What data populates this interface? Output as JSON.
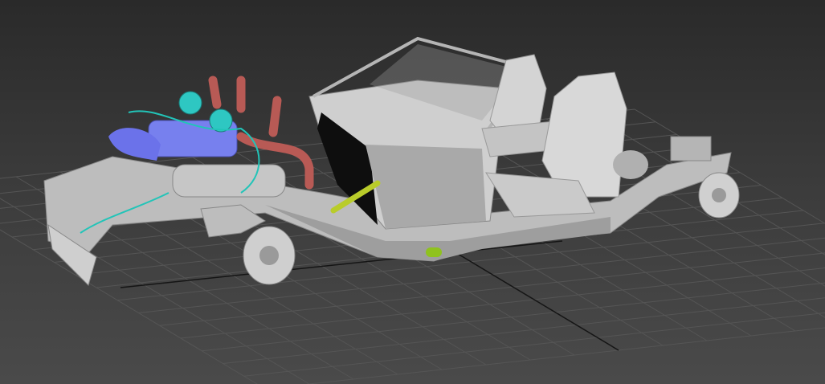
{
  "viewport": {
    "background_top": "#2a2a2a",
    "background_bottom": "#4a4a4a",
    "grid_color": "#555555",
    "axis_color": "#111111"
  },
  "model": {
    "chassis_color": "#c8c8c8",
    "engine_color": "#6f77ee",
    "exhaust_color": "#b85a55",
    "wire_color": "#22c4b8",
    "rod_color": "#b9cc2a"
  }
}
